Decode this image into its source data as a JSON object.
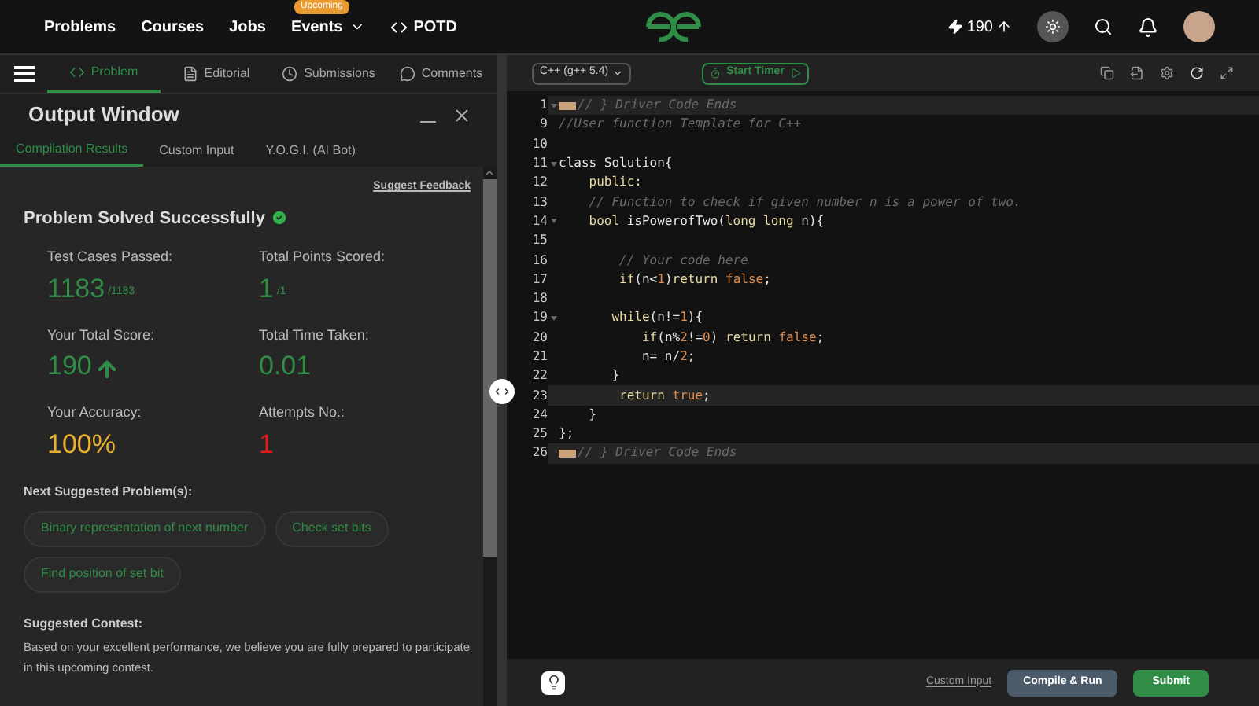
{
  "nav": {
    "links": [
      {
        "label": "Problems",
        "caret": false,
        "code_icon": false
      },
      {
        "label": "Courses",
        "caret": false,
        "code_icon": false
      },
      {
        "label": "Jobs",
        "caret": false,
        "code_icon": false
      },
      {
        "label": "Events",
        "badge": "Upcoming",
        "caret": true,
        "code_icon": false
      },
      {
        "label": "POTD",
        "caret": false,
        "code_icon": true
      }
    ],
    "score": "190"
  },
  "problem_tabs": [
    {
      "label": "Problem",
      "selected": true
    },
    {
      "label": "Editorial",
      "selected": false
    },
    {
      "label": "Submissions",
      "selected": false
    },
    {
      "label": "Comments",
      "selected": false
    }
  ],
  "output_window": {
    "title": "Output Window",
    "tabs": [
      {
        "label": "Compilation Results",
        "selected": true
      },
      {
        "label": "Custom Input",
        "selected": false
      },
      {
        "label": "Y.O.G.I. (AI Bot)",
        "selected": false
      }
    ],
    "feedback_link": "Suggest Feedback",
    "heading": "Problem Solved Successfully",
    "stats": [
      {
        "label": "Test Cases Passed:",
        "value": "1183",
        "suffix": "/1183",
        "arrow": false,
        "color": "#2f8d46"
      },
      {
        "label": "Total Points Scored:",
        "value": "1",
        "suffix": "/1",
        "arrow": false,
        "color": "#2f8d46"
      },
      {
        "label": "Your Total Score:",
        "value": "190",
        "arrow": true,
        "color": "#2f8d46"
      },
      {
        "label": "Total Time Taken:",
        "value": "0.01",
        "arrow": false,
        "color": "#2f8d46"
      },
      {
        "label": "Your Accuracy:",
        "value": "100%",
        "arrow": false,
        "color": "#e8b230"
      },
      {
        "label": "Attempts No.:",
        "value": "1",
        "arrow": false,
        "color": "#e01b1b"
      }
    ],
    "next_heading": "Next Suggested Problem(s):",
    "suggestions": [
      "Binary representation of next number",
      "Check set bits",
      "Find position of set bit"
    ],
    "contest_heading": "Suggested Contest:",
    "contest_text": "Based on your excellent performance, we believe you are fully prepared to participate in this upcoming contest."
  },
  "editor": {
    "language": "C++ (g++ 5.4)",
    "timer": "Start Timer",
    "lines": [
      {
        "num": "1",
        "fold": true,
        "highlighted": true,
        "marker": true,
        "segments": [
          {
            "kind": "comment",
            "text": "// } Driver Code Ends"
          }
        ]
      },
      {
        "num": "9",
        "fold": false,
        "highlighted": false,
        "marker": false,
        "segments": [
          {
            "kind": "comment",
            "text": "//User function Template for C++"
          }
        ]
      },
      {
        "num": "10",
        "fold": false,
        "highlighted": false,
        "marker": false
      },
      {
        "num": "11",
        "fold": true,
        "highlighted": false,
        "marker": false,
        "segments": [
          {
            "kind": "plain",
            "text": "class Solution{"
          }
        ]
      },
      {
        "num": "12",
        "fold": false,
        "highlighted": false,
        "marker": false,
        "segments": [
          {
            "kind": "keyword",
            "text": "    public:"
          }
        ]
      },
      {
        "num": "13",
        "fold": false,
        "highlighted": false,
        "marker": false,
        "segments": [
          {
            "kind": "comment",
            "text": "    // Function to check if given number n is a power of two."
          }
        ]
      },
      {
        "num": "14",
        "fold": true,
        "highlighted": false,
        "marker": false,
        "segments": [
          {
            "kind": "keyword",
            "text": "    bool"
          },
          {
            "kind": "plain",
            "text": " isPowerofTwo("
          },
          {
            "kind": "keyword",
            "text": "long long"
          },
          {
            "kind": "plain",
            "text": " n){"
          }
        ]
      },
      {
        "num": "15",
        "fold": false,
        "highlighted": false,
        "marker": false
      },
      {
        "num": "16",
        "fold": false,
        "highlighted": false,
        "marker": false,
        "segments": [
          {
            "kind": "comment",
            "text": "        // Your code here"
          }
        ]
      },
      {
        "num": "17",
        "fold": false,
        "highlighted": false,
        "marker": false,
        "segments": [
          {
            "kind": "keyword",
            "text": "        if"
          },
          {
            "kind": "plain",
            "text": "(n<"
          },
          {
            "kind": "number",
            "text": "1"
          },
          {
            "kind": "plain",
            "text": ")"
          },
          {
            "kind": "keyword",
            "text": "return"
          },
          {
            "kind": "number",
            "text": " false"
          },
          {
            "kind": "plain",
            "text": ";"
          }
        ]
      },
      {
        "num": "18",
        "fold": false,
        "highlighted": false,
        "marker": false
      },
      {
        "num": "19",
        "fold": true,
        "highlighted": false,
        "marker": false,
        "segments": [
          {
            "kind": "keyword",
            "text": "       while"
          },
          {
            "kind": "plain",
            "text": "(n!="
          },
          {
            "kind": "number",
            "text": "1"
          },
          {
            "kind": "plain",
            "text": "){"
          }
        ]
      },
      {
        "num": "20",
        "fold": false,
        "highlighted": false,
        "marker": false,
        "segments": [
          {
            "kind": "keyword",
            "text": "           if"
          },
          {
            "kind": "plain",
            "text": "(n%"
          },
          {
            "kind": "number",
            "text": "2"
          },
          {
            "kind": "plain",
            "text": "!="
          },
          {
            "kind": "number",
            "text": "0"
          },
          {
            "kind": "plain",
            "text": ") "
          },
          {
            "kind": "keyword",
            "text": "return"
          },
          {
            "kind": "number",
            "text": " false"
          },
          {
            "kind": "plain",
            "text": ";"
          }
        ]
      },
      {
        "num": "21",
        "fold": false,
        "highlighted": false,
        "marker": false,
        "segments": [
          {
            "kind": "plain",
            "text": "           n= n/"
          },
          {
            "kind": "number",
            "text": "2"
          },
          {
            "kind": "plain",
            "text": ";"
          }
        ]
      },
      {
        "num": "22",
        "fold": false,
        "highlighted": false,
        "marker": false,
        "segments": [
          {
            "kind": "plain",
            "text": "       }"
          }
        ]
      },
      {
        "num": "23",
        "fold": false,
        "highlighted": true,
        "marker": false,
        "segments": [
          {
            "kind": "keyword",
            "text": "        return"
          },
          {
            "kind": "number",
            "text": " true"
          },
          {
            "kind": "plain",
            "text": ";"
          }
        ]
      },
      {
        "num": "24",
        "fold": false,
        "highlighted": false,
        "marker": false,
        "segments": [
          {
            "kind": "plain",
            "text": "    }"
          }
        ]
      },
      {
        "num": "25",
        "fold": false,
        "highlighted": false,
        "marker": false,
        "segments": [
          {
            "kind": "plain",
            "text": "};"
          }
        ]
      },
      {
        "num": "26",
        "fold": false,
        "highlighted": true,
        "marker": true,
        "segments": [
          {
            "kind": "comment",
            "text": "// } Driver Code Ends"
          }
        ]
      }
    ],
    "custom_input": "Custom Input",
    "compile_button": "Compile & Run",
    "submit_button": "Submit"
  }
}
